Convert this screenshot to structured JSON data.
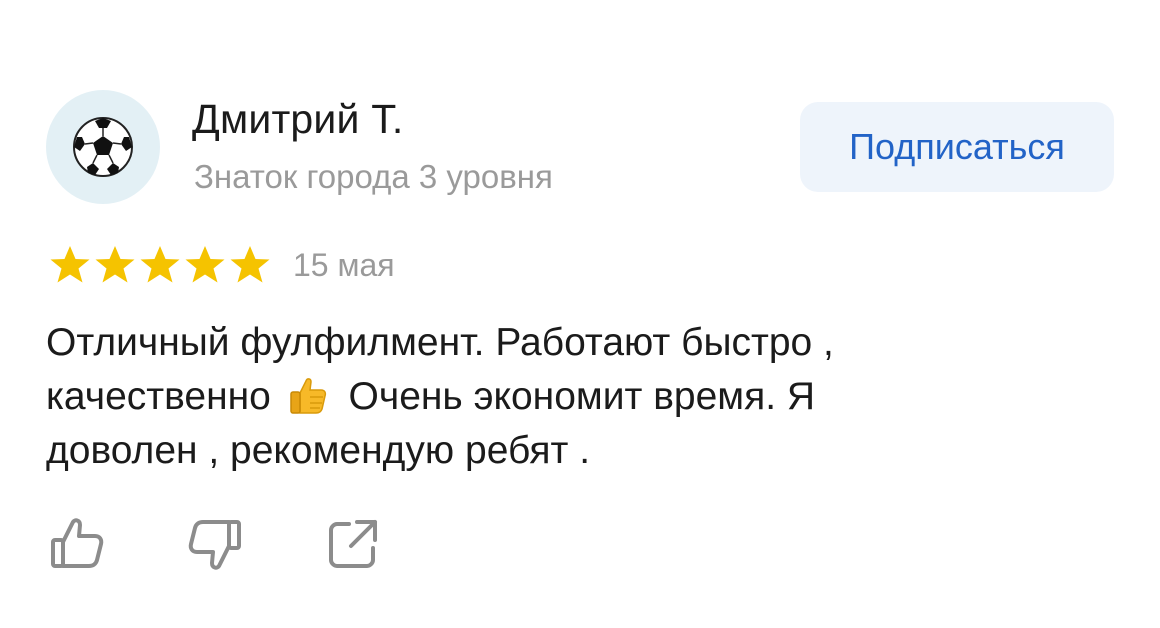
{
  "author": {
    "name": "Дмитрий Т.",
    "level": "Знаток города 3 уровня",
    "avatar_icon": "soccer-ball-icon"
  },
  "subscribe": {
    "label": "Подписаться"
  },
  "review": {
    "rating": 5,
    "rating_max": 5,
    "date": "15 мая",
    "text_lines": [
      "Отличный фулфилмент. Работают быстро ,",
      "качественно",
      "Очень экономит время. Я",
      "доволен , рекомендую ребят ."
    ],
    "emoji_icon": "thumbs-up-emoji"
  },
  "actions": {
    "icons": [
      "like-icon",
      "dislike-icon",
      "share-icon"
    ]
  },
  "colors": {
    "star": "#f5c300",
    "accent": "#2263c7",
    "button_bg": "#eef4fb",
    "muted_text": "#9a9a9a",
    "icon_gray": "#8c8c8c",
    "avatar_bg": "#e3f0f5"
  }
}
